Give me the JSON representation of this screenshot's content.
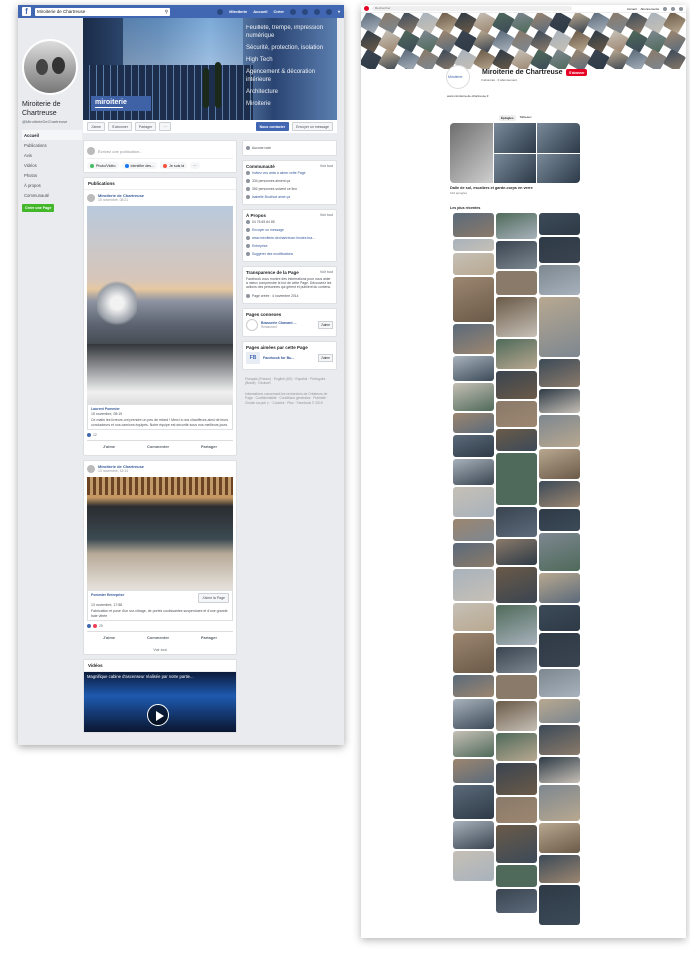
{
  "facebook": {
    "search_value": "Miroiterie de Chartreuse",
    "top_nav": [
      "Miroiterie",
      "Accueil",
      "Créer"
    ],
    "page_name": "Miroiterie de Chartreuse",
    "page_handle": "@MiroiterieDeChartreuse",
    "left_menu": [
      "Accueil",
      "Publications",
      "Avis",
      "Vidéos",
      "Photos",
      "À propos",
      "Communauté"
    ],
    "create_page_label": "Créer une Page",
    "cover_logo": "miroiterie",
    "cover_services": [
      "Feuilleté, trempé, impression numérique",
      "Sécurité, protection, isolation",
      "High Tech",
      "Agencement & décoration intérieure",
      "Architecture",
      "Miroiterie"
    ],
    "actions": {
      "like": "J'aime",
      "follow": "S'abonner",
      "share": "Partager",
      "more": "···",
      "contact": "Nous contacter",
      "message": "Envoyer un message"
    },
    "composer": {
      "placeholder": "Écrivez une publication...",
      "photo": "Photo/Vidéo",
      "tag": "Identifier des...",
      "checkin": "Je suis là",
      "more": "···"
    },
    "publications_title": "Publications",
    "post1": {
      "author": "Miroiterie de Chartreuse",
      "date": "15 novembre, 08:21",
      "shared_name": "Laurent Pommier",
      "shared_date": "15 novembre, 08:19",
      "shared_text": "Ce matin les livreurs ont prendre un peu de retard ! Merci à nos chauffeurs ainsi de leurs conducteurs et nos camions équipés. Notre équipe est sécurité sous nos meilleurs jours.",
      "reactions": "12"
    },
    "post2": {
      "author": "Miroiterie de Chartreuse",
      "date": "13 novembre, 18:14",
      "shared_name": "Pommier Entreprise",
      "shared_date": "13 novembre, 17:58",
      "shared_text": "Fabrication et pose d'un sur-vitrage, de portes coulissantes suspendues et d'une grande baie vitrée",
      "like_page": "J'aime la Page",
      "reactions": "29"
    },
    "post_actions": {
      "like": "J'aime",
      "comment": "Commenter",
      "share": "Partager"
    },
    "see_all": "Voir tout",
    "videos_title": "Vidéos",
    "video_caption": "Magnifique cabine d'ascenseur réalisée par notre partie...",
    "sidebar": {
      "rating": "Aucune note",
      "community_title": "Communauté",
      "see_all": "Voir tout",
      "community_lines": [
        "Invitez vos amis à aimer cette Page",
        "334 personnes aiment ça",
        "352 personnes suivent ce lieu",
        "Isabelle Bouthod aime ça"
      ],
      "about_title": "À Propos",
      "about_lines": [
        "04 76 65 64 85",
        "Envoyer un message",
        "www.miroiterie-dechartreuse-hrodes.bra...",
        "Entreprise",
        "Suggérer des modifications"
      ],
      "transparency_title": "Transparence de la Page",
      "transparency_text": "Facebook vous montre des informations pour vous aider à mieux comprendre le but de cette Page. Découvrez les actions des personnes qui gèrent et publient du contenu.",
      "created": "Page créée : 4 novembre 2014",
      "related_title": "Pages connexes",
      "related_name": "Brasserie Chavant ...",
      "related_cat": "Restaurant",
      "liked_title": "Pages aimées par cette Page",
      "liked_name": "Facebook for Bu...",
      "like_btn": "J'aime",
      "languages": "Français (France) · English (US) · Español · Português (Brasil) · Deutsch",
      "footer": "Informations concernant les recherches de Créateurs de Page · Confidentialité · Conditions générales · Publicité · Choisir sa pub ▷ · Cookies · Plus · Facebook © 2019"
    }
  },
  "pinterest": {
    "search_placeholder": "Rechercher",
    "nav": [
      "Accueil",
      "Abonnements"
    ],
    "profile_logo": "Miroiterie",
    "title": "Miroiterie de Chartreuse",
    "followers": "3 abonnés · 0 abonnement",
    "follow_btn": "S'abonner",
    "url": "www.miroiterie-de-chartreuse.fr",
    "tabs": [
      "Épingles",
      "Tableaux"
    ],
    "board_title": "Dalle de sol, escaliers et garde-corps en verre",
    "board_sub": "194 épingles",
    "popular_title": "Les plus récentes"
  },
  "colors": {
    "fb_blue": "#4267b2",
    "pin_red": "#e60023",
    "fb_bg": "#e9ebee"
  }
}
